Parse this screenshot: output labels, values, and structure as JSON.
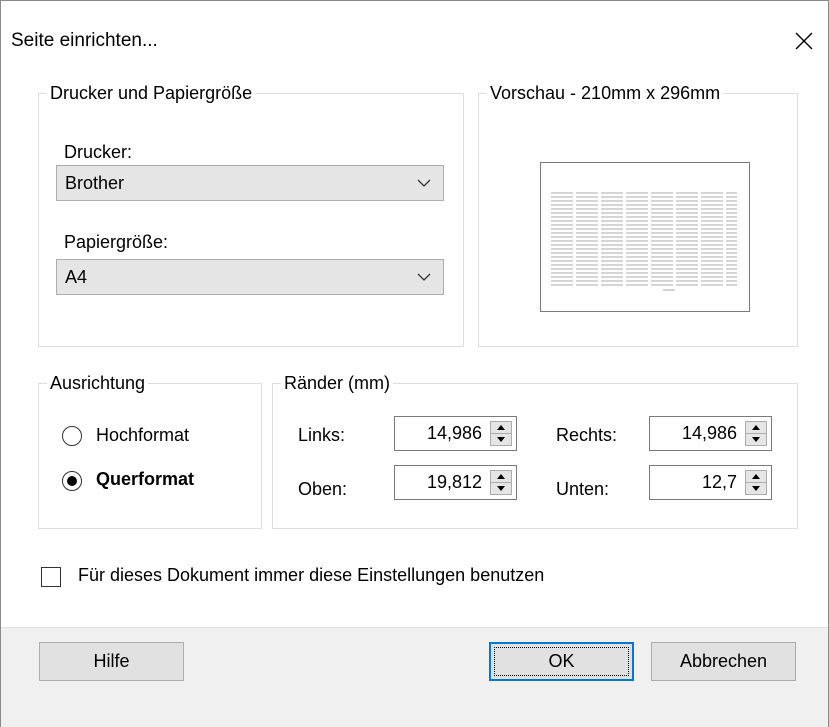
{
  "dialog": {
    "title": "Seite einrichten...",
    "close_glyph": "✕"
  },
  "printer_group": {
    "legend": "Drucker und Papiergröße",
    "printer_label": "Drucker:",
    "printer_value": "Brother",
    "paper_label": "Papiergröße:",
    "paper_value": "A4"
  },
  "preview": {
    "legend": "Vorschau - 210mm x 296mm"
  },
  "orientation": {
    "legend": "Ausrichtung",
    "portrait_label": "Hochformat",
    "landscape_label": "Querformat",
    "selected": "Querformat"
  },
  "margins": {
    "legend": "Ränder (mm)",
    "left_label": "Links:",
    "left_value": "14,986",
    "right_label": "Rechts:",
    "right_value": "14,986",
    "top_label": "Oben:",
    "top_value": "19,812",
    "bottom_label": "Unten:",
    "bottom_value": "12,7"
  },
  "always_use": {
    "label": "Für dieses Dokument immer diese Einstellungen benutzen",
    "checked": false
  },
  "buttons": {
    "help": "Hilfe",
    "ok": "OK",
    "cancel": "Abbrechen"
  },
  "colors": {
    "accent": "#0078d7",
    "window": "#ffffff",
    "footer": "#f0f0f0"
  }
}
